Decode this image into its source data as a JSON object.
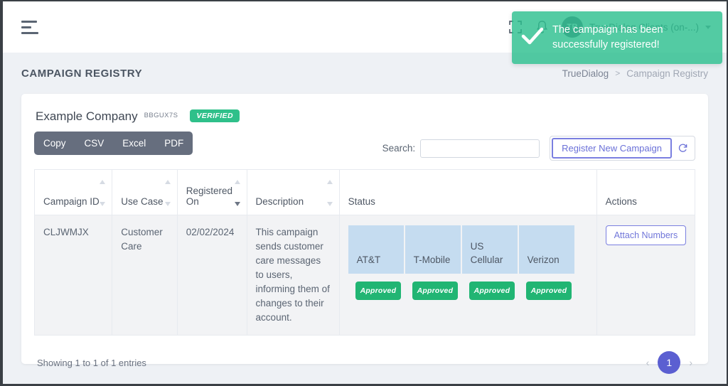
{
  "navbar": {
    "menu_icon": "hamburger-icon",
    "fullscreen_icon": "fullscreen-icon",
    "bell_icon": "bell-icon",
    "avatar_initials": "TR",
    "user_name": "TrueDialog Clients (on-...)"
  },
  "toast": {
    "message": "The campaign has been successfully registered!",
    "icon": "check-icon",
    "bg_color": "#28be8c"
  },
  "pagebar": {
    "title": "CAMPAIGN REGISTRY",
    "breadcrumb": {
      "root": "TrueDialog",
      "separator": ">",
      "current": "Campaign Registry"
    }
  },
  "card": {
    "company_name": "Example Company",
    "company_code": "BBGUX7S",
    "verified_label": "VERIFIED",
    "export_buttons": [
      {
        "label": "Copy"
      },
      {
        "label": "CSV"
      },
      {
        "label": "Excel"
      },
      {
        "label": "PDF"
      }
    ],
    "search": {
      "label": "Search:",
      "value": "",
      "placeholder": ""
    },
    "register_button": "Register New Campaign",
    "refresh_icon": "refresh-icon"
  },
  "table": {
    "columns": [
      {
        "label": "Campaign ID",
        "sortable": true,
        "sorted": "none"
      },
      {
        "label": "Use Case",
        "sortable": true,
        "sorted": "none"
      },
      {
        "label": "Registered On",
        "sortable": true,
        "sorted": "desc"
      },
      {
        "label": "Description",
        "sortable": true,
        "sorted": "none"
      },
      {
        "label": "Status",
        "sortable": false,
        "sorted": "none"
      },
      {
        "label": "Actions",
        "sortable": false,
        "sorted": "none"
      }
    ],
    "carriers": [
      {
        "name": "AT&T",
        "status": "Approved"
      },
      {
        "name": "T-Mobile",
        "status": "Approved"
      },
      {
        "name": "US Cellular",
        "status": "Approved"
      },
      {
        "name": "Verizon",
        "status": "Approved"
      }
    ],
    "rows": [
      {
        "campaign_id": "CLJWMJX",
        "use_case": "Customer Care",
        "registered_on": "02/02/2024",
        "description": "This campaign sends customer care messages to users, informing them of changes to their account.",
        "action_label": "Attach Numbers"
      }
    ]
  },
  "footer": {
    "entries_info": "Showing 1 to 1 of 1 entries",
    "prev_label": "‹",
    "next_label": "›",
    "current_page": "1"
  },
  "colors": {
    "accent_purple": "#5b5fd1",
    "success_green": "#21b573",
    "carrier_header_blue": "#c5dcf0",
    "export_slate": "#666e7e"
  }
}
